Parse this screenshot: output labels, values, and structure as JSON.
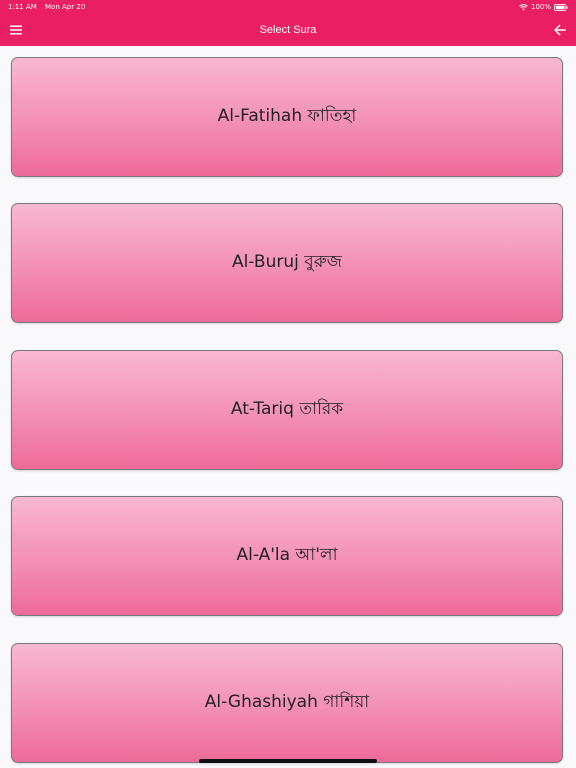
{
  "status_bar": {
    "time": "1:11 AM",
    "date": "Mon Apr 20",
    "battery": "100%"
  },
  "app_bar": {
    "title": "Select Sura",
    "left_icon": "menu-icon",
    "right_icon": "arrow-left-icon"
  },
  "suras": [
    {
      "label": "Al-Fatihah ফাতিহা"
    },
    {
      "label": "Al-Buruj বুরুজ"
    },
    {
      "label": "At-Tariq তারিক"
    },
    {
      "label": "Al-A'la আ'লা"
    },
    {
      "label": "Al-Ghashiyah গাশিয়া"
    }
  ],
  "colors": {
    "accent": "#e91e63",
    "button_top": "#f8b8d0",
    "button_bottom": "#ee6b98",
    "background": "#f9f9fb"
  }
}
